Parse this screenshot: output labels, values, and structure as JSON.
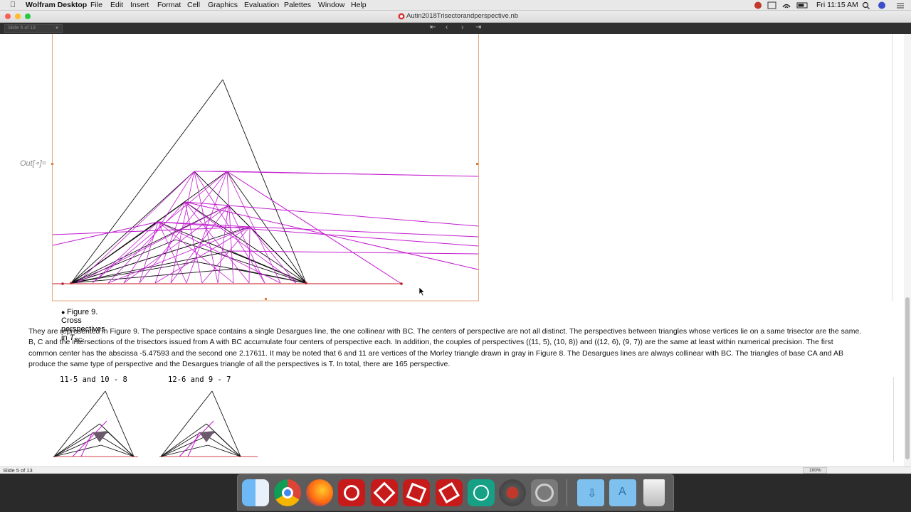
{
  "menubar": {
    "app": "Wolfram Desktop",
    "items": [
      "File",
      "Edit",
      "Insert",
      "Format",
      "Cell",
      "Graphics",
      "Evaluation",
      "Palettes",
      "Window",
      "Help"
    ],
    "clock": "Fri 11:15 AM"
  },
  "window": {
    "title": "Autin2018Trisectorandperspective.nb"
  },
  "slide_toolbar": {
    "selector": "Slide 5 of 13"
  },
  "cell": {
    "out_label": "Out[∘]=",
    "caption_main": "Figure 9. Cross perspectives in ",
    "caption_var": "T",
    "caption_sub": "BC",
    "caption_end": ".",
    "paragraph": "They are represented in Figure 9. The perspective space contains a single Desargues line, the one collinear with BC. The centers of perspective are not all distinct. The perspectives between triangles whose vertices lie on a same trisector are the same. B, C and the intersections of the trisectors issued from A with BC accumulate four centers of perspective each. In addition, the couples of perspectives ((11, 5), (10, 8)) and ((12, 6), (9, 7)) are the same at least within numerical precision. The first common center has the abscissa -5.47593 and the second one 2.17611. It may be noted that 6 and 11 are vertices of the Morley triangle drawn in gray in Figure 8. The Desargues lines are always collinear with BC. The triangles of base CA and AB produce the same type of perspective and the Desargues triangle of all the perspectives is T. In total, there are 165 perspective.",
    "label_left": "11-5 and 10 - 8",
    "label_right": "12-6 and 9 - 7"
  },
  "statusbar": {
    "slide": "Slide 5 of 13",
    "zoom": "100%"
  },
  "dock": {
    "apps": [
      "finder",
      "chrome",
      "firefox",
      "wolfram-1",
      "wolfram-2",
      "wolfram-3",
      "wolfram-4",
      "wolfram-player",
      "system-utility",
      "system-preferences",
      "downloads-folder",
      "applications-folder",
      "trash"
    ]
  }
}
